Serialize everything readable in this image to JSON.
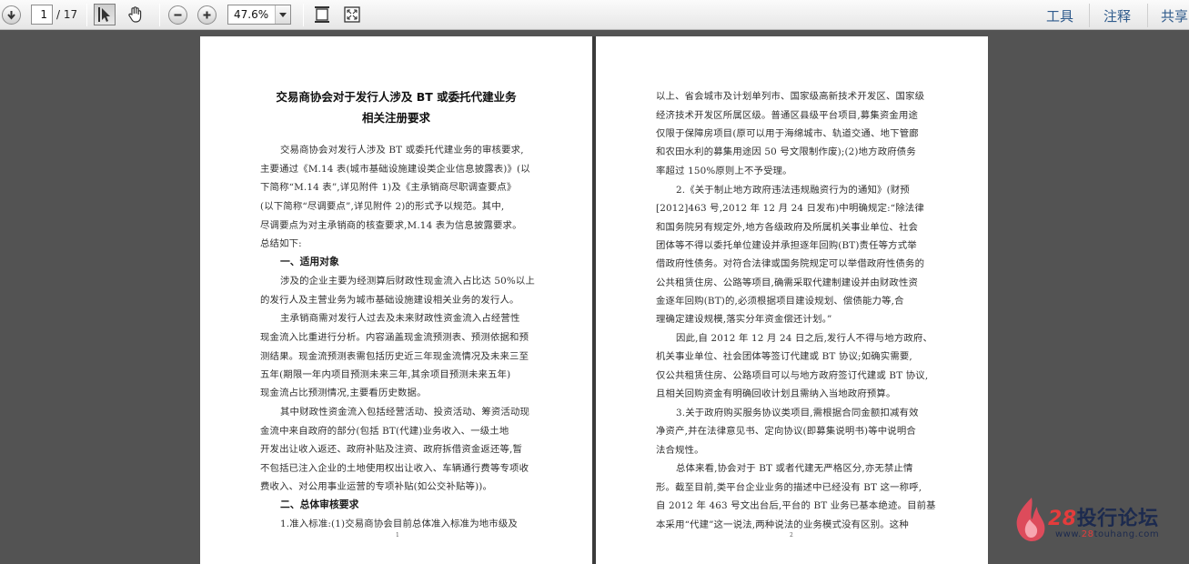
{
  "toolbar": {
    "current_page": "1",
    "total_pages": "/ 17",
    "zoom": "47.6%",
    "tools_label": "工具",
    "comment_label": "注释",
    "share_label": "共享"
  },
  "page1": {
    "title_line1": "交易商协会对于发行人涉及 BT 或委托代建业务",
    "title_line2": "相关注册要求",
    "lines": [
      "交易商协会对发行人涉及 BT 或委托代建业务的审核要求,",
      "主要通过《M.14 表(城市基础设施建设类企业信息披露表)》(以",
      "下简称“M.14 表”,详见附件 1)及《主承销商尽职调查要点》",
      "(以下简称“尽调要点”,详见附件 2)的形式予以规范。其中,",
      "尽调要点为对主承销商的核查要求,M.14 表为信息披露要求。",
      "总结如下:"
    ],
    "heading1": "一、适用对象",
    "lines2": [
      "涉及的企业主要为经测算后财政性现金流入占比达 50%以上",
      "的发行人及主营业务为城市基础设施建设相关业务的发行人。",
      "主承销商需对发行人过去及未来财政性资金流入占经营性",
      "现金流入比重进行分析。内容涵盖现金流预测表、预测依据和预",
      "测结果。现金流预测表需包括历史近三年现金流情况及未来三至",
      "五年(期限一年内项目预测未来三年,其余项目预测未来五年)",
      "现金流占比预测情况,主要看历史数据。",
      "其中财政性资金流入包括经营活动、投资活动、筹资活动现",
      "金流中来自政府的部分(包括 BT(代建)业务收入、一级土地",
      "开发出让收入返还、政府补贴及注资、政府拆借资金返还等,暂",
      "不包括已注入企业的土地使用权出让收入、车辆通行费等专项收",
      "费收入、对公用事业运营的专项补贴(如公交补贴等))。"
    ],
    "heading2": "二、总体审核要求",
    "lines3": [
      "1.准入标准:(1)交易商协会目前总体准入标准为地市级及"
    ],
    "page_number": "1"
  },
  "page2": {
    "lines": [
      "以上、省会城市及计划单列市、国家级高新技术开发区、国家级",
      "经济技术开发区所属区级。普通区县级平台项目,募集资金用途",
      "仅限于保障房项目(原可以用于海绵城市、轨道交通、地下管廊",
      "和农田水利的募集用途因 50 号文限制作废);(2)地方政府债务",
      "率超过 150%原则上不予受理。",
      "2.《关于制止地方政府违法违规融资行为的通知》(财预",
      "[2012]463 号,2012 年 12 月 24 日发布)中明确规定:“除法律",
      "和国务院另有规定外,地方各级政府及所属机关事业单位、社会",
      "团体等不得以委托单位建设并承担逐年回购(BT)责任等方式举",
      "借政府性债务。对符合法律或国务院规定可以举借政府性债务的",
      "公共租赁住房、公路等项目,确需采取代建制建设并由财政性资",
      "金逐年回购(BT)的,必须根据项目建设规划、偿债能力等,合",
      "理确定建设规模,落实分年资金偿还计划。”",
      "因此,自 2012 年 12 月 24 日之后,发行人不得与地方政府、",
      "机关事业单位、社会团体等签订代建或 BT 协议;如确实需要,",
      "仅公共租赁住房、公路项目可以与地方政府签订代建或 BT 协议,",
      "且相关回购资金有明确回收计划且需纳入当地政府预算。",
      "3.关于政府购买服务协议类项目,需根据合同金额扣减有效",
      "净资产,并在法律意见书、定向协议(即募集说明书)等中说明合",
      "法合规性。",
      "总体来看,协会对于 BT 或者代建无严格区分,亦无禁止情",
      "形。截至目前,类平台企业业务的描述中已经没有 BT 这一称呼,",
      "自 2012 年 463 号文出台后,平台的 BT 业务已基本绝迹。目前基",
      "本采用“代建”这一说法,两种说法的业务模式没有区别。这种"
    ],
    "page_number": "2"
  },
  "watermark": {
    "brand_num": "28",
    "brand_text": "投行论坛",
    "url_prefix": "www.",
    "url_red": "28",
    "url_suffix": "touhang.com"
  }
}
